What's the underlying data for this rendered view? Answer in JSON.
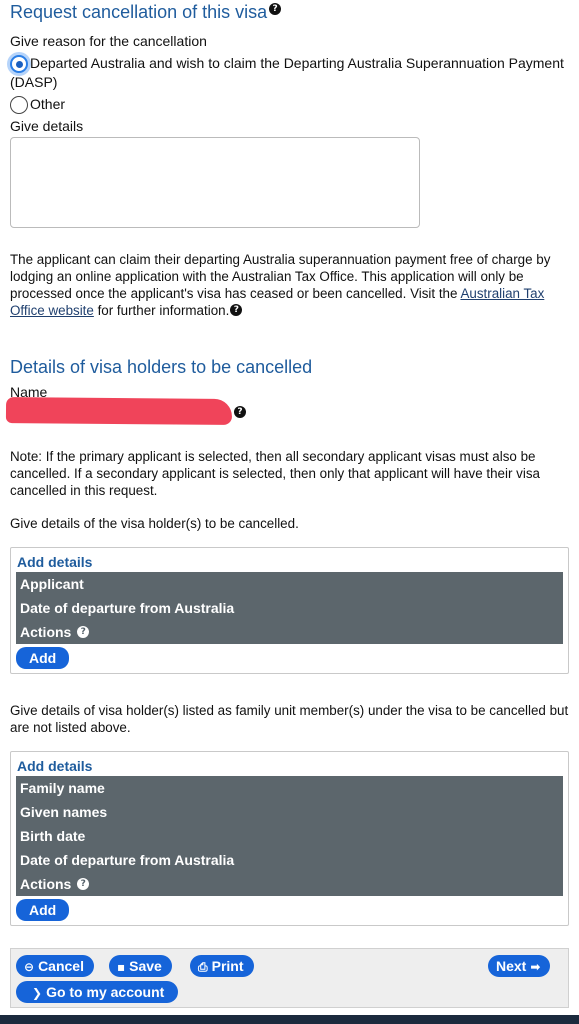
{
  "cancel_section": {
    "title": "Request cancellation of this visa",
    "reason_label": "Give reason for the cancellation",
    "reason_option_1": "Departed Australia and wish to claim the Departing Australia Superannuation Payment (DASP)",
    "reason_option_2": "Other",
    "details_label": "Give details",
    "details_value": ""
  },
  "dasp_note": {
    "text_before_link": "The applicant can claim their departing Australia superannuation payment free of charge by lodging an online application with the Australian Tax Office. This application will only be processed once the applicant's visa has ceased or been cancelled. Visit the ",
    "link_text": "Australian Tax Office website",
    "text_after_link": " for further information."
  },
  "holders_section": {
    "title": "Details of visa holders to be cancelled",
    "name_label": "Name",
    "note": "Note: If the primary applicant is selected, then all secondary applicant visas must also be cancelled. If a secondary applicant is selected, then only that applicant will have their visa cancelled in this request.",
    "give_details_label": "Give details of the visa holder(s) to be cancelled."
  },
  "holders_table": {
    "title": "Add details",
    "columns": [
      "Applicant",
      "Date of departure from Australia",
      "Actions"
    ],
    "add_label": "Add"
  },
  "family_label": "Give details of visa holder(s) listed as family unit member(s) under the visa to be cancelled but are not listed above.",
  "family_table": {
    "title": "Add details",
    "columns": [
      "Family name",
      "Given names",
      "Birth date",
      "Date of departure from Australia",
      "Actions"
    ],
    "add_label": "Add"
  },
  "navigation": {
    "cancel": "Cancel",
    "save": "Save",
    "print": "Print",
    "next": "Next",
    "account": "Go to my account"
  },
  "colors": {
    "heading": "#1f5c9d",
    "button": "#1664d9",
    "grid_header": "#5c666c",
    "redaction": "#f0445a"
  }
}
